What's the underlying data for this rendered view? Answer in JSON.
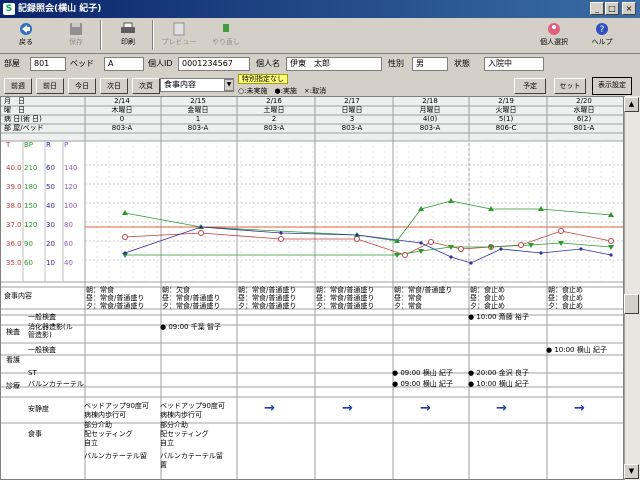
{
  "window": {
    "title": "記録照会(横山 紀子)"
  },
  "toolbar": {
    "back": "戻る",
    "save": "保存",
    "print": "印刷",
    "preview": "プレビュー",
    "redo": "やり直し",
    "select_person": "個人選択",
    "help": "ヘルプ"
  },
  "patient": {
    "room_label": "部屋",
    "room": "801",
    "bed_label": "ベッド",
    "bed": "A",
    "id_label": "個人ID",
    "id": "0001234567",
    "name_label": "個人名",
    "name": "伊東　太郎",
    "sex_label": "性別",
    "sex": "男",
    "status_label": "状態",
    "status": "入院中"
  },
  "nav": {
    "prev_week": "前週",
    "prev_day": "前日",
    "today": "今日",
    "next_day": "次日",
    "next_week": "次頁",
    "category_select": "食事内容",
    "special_badge": "特別指定なし",
    "legend": "○:未実施　●:実施　×:取消",
    "schedule": "予定",
    "set": "セット",
    "display_settings": "表示設定"
  },
  "header_labels": {
    "month_day": "月　日",
    "weekday": "曜　日",
    "hospital_day": "病 日(術 日)",
    "room_bed": "部 屋/ベッド"
  },
  "days": [
    {
      "date": "2/14",
      "weekday": "木曜日",
      "hday": "0",
      "room": "803-A"
    },
    {
      "date": "2/15",
      "weekday": "金曜日",
      "hday": "1",
      "room": "803-A"
    },
    {
      "date": "2/16",
      "weekday": "土曜日",
      "hday": "2",
      "room": "803-A"
    },
    {
      "date": "2/17",
      "weekday": "日曜日",
      "hday": "3",
      "room": "803-A"
    },
    {
      "date": "2/18",
      "weekday": "月曜日",
      "hday": "4(0)",
      "room": "803-A"
    },
    {
      "date": "2/19",
      "weekday": "火曜日",
      "hday": "5(1)",
      "room": "806-C"
    },
    {
      "date": "2/20",
      "weekday": "水曜日",
      "hday": "6(2)",
      "room": "801-A"
    }
  ],
  "vital_axes": {
    "headers": [
      "T",
      "BP",
      "R",
      "P"
    ],
    "rows": [
      [
        "40.0",
        "210",
        "60",
        "140"
      ],
      [
        "39.0",
        "180",
        "50",
        "120"
      ],
      [
        "38.0",
        "150",
        "40",
        "100"
      ],
      [
        "37.0",
        "120",
        "30",
        "80"
      ],
      [
        "36.0",
        "90",
        "20",
        "60"
      ],
      [
        "35.0",
        "60",
        "10",
        "40"
      ]
    ]
  },
  "rows": {
    "meal_label": "食事内容",
    "meals": [
      "朝：常食\n昼：常食/普通盛り\n夕：常食/普通盛り",
      "朝：欠食\n昼：常食/普通盛り\n夕：常食/普通盛り",
      "朝：常食/普通盛り\n昼：常食/普通盛り\n夕：常食/普通盛り",
      "朝：常食/普通盛り\n昼：常食/普通盛り\n夕：常食/普通盛り",
      "朝：常食/普通盛り\n昼：常食\n夕：常食",
      "朝：食止め\n昼：食止め\n夕：食止め",
      "朝：食止め\n昼：食止め\n夕：食止め"
    ],
    "exam_label": "検査",
    "exam_general": "一般検査",
    "exam_gi": "消化器造影(ル\n管造影)",
    "nursing_label": "看護",
    "treatment_label": "診療",
    "st": "ST",
    "balloon": "バルンカテーテル",
    "rest_label": "安静度",
    "food_label": "食事",
    "entries": {
      "exam_general_d5": "● 10:00 斎藤 裕子",
      "exam_gi_d1": "● 09:00 千葉 智子",
      "general_d6": "● 10:00 横山 紀子",
      "st_d4": "● 09:00 横山 紀子",
      "st_d5": "● 20:00 金沢 良子",
      "balloon_d4": "● 09:00 横山 紀子",
      "balloon_d5": "● 10:00 横山 紀子",
      "rest_d0": "ベッドアップ90度可\n病棟内歩行可",
      "rest_d1": "ベッドアップ90度可\n病棟内歩行可",
      "food_d0": "部分介助\n配セッティング\n自立",
      "food_d1": "部分介助\n配セッティング\n自立",
      "last_d0": "バルンカテーテル留",
      "last_d1": "バルンカテーテル留\n置"
    }
  },
  "colors": {
    "temp": "#c04040",
    "bp": "#2a9a2a",
    "resp": "#3030a0",
    "pulse": "#9060c0",
    "arrow": "#1c3fa8"
  }
}
